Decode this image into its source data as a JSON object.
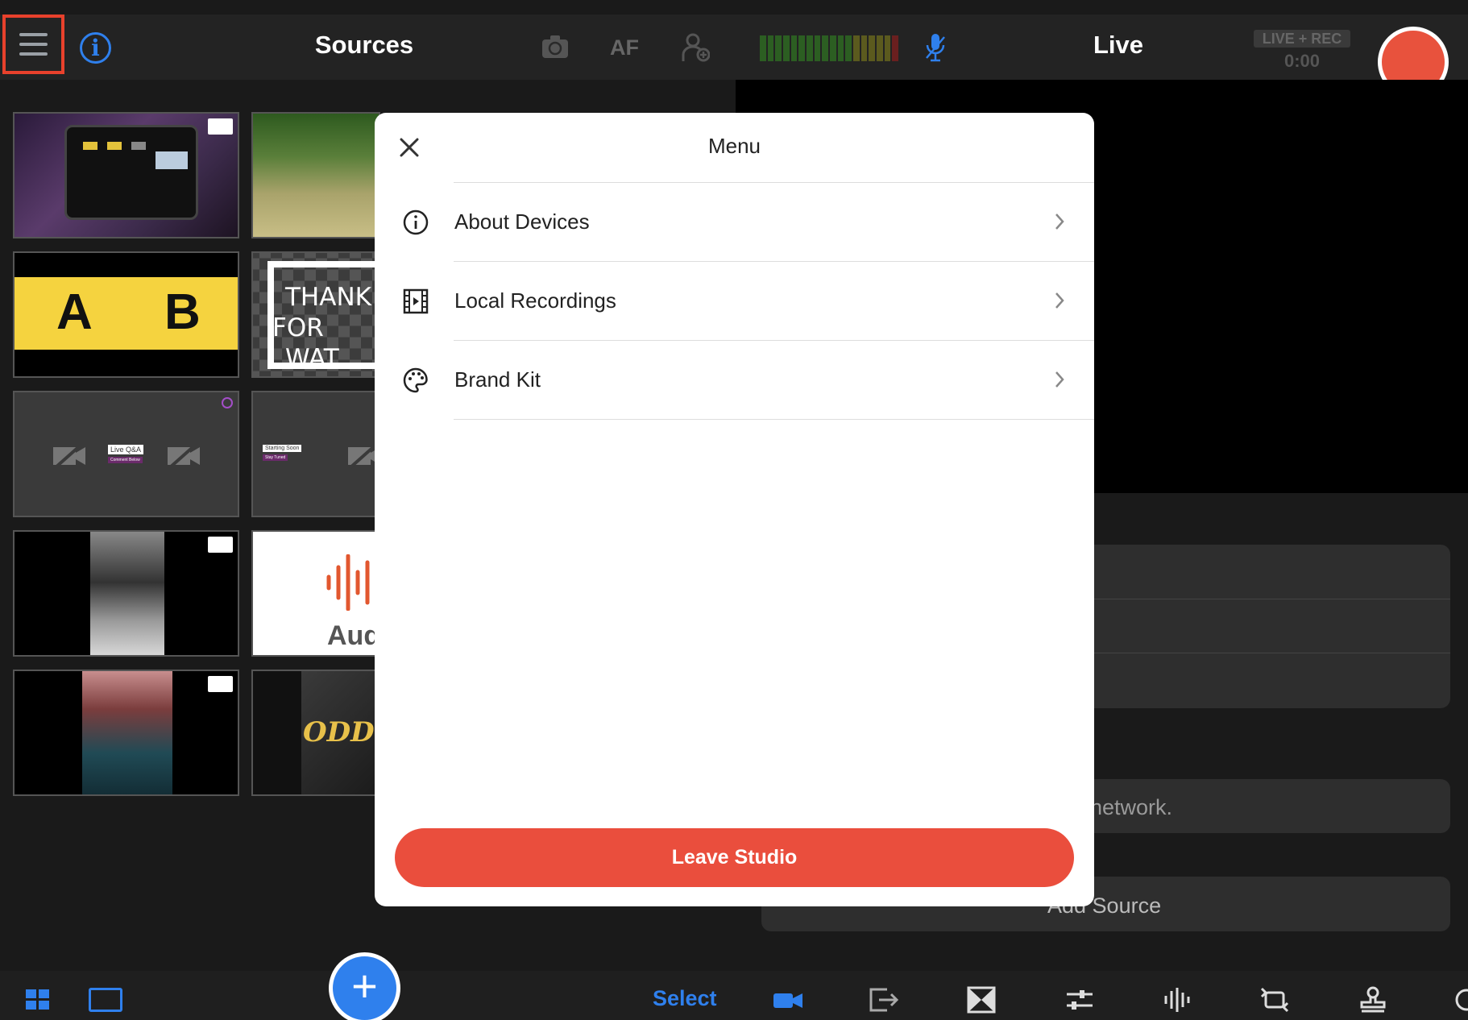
{
  "sources_panel": {
    "title": "Sources",
    "af_label": "AF",
    "tiles": {
      "thanks_text_line1": "THANK",
      "thanks_text_line2": "FOR WAT",
      "ab_left": "A",
      "ab_right": "B",
      "qa_label": "Live Q&A",
      "qa_sub": "Comment Below",
      "starting_label": "Starting Soon",
      "starting_sub": "Stay Tuned",
      "audio_label": "Aud",
      "odds_label": "ODDS"
    },
    "select_label": "Select",
    "add_label": "+"
  },
  "live_panel": {
    "title": "Live",
    "status_badge": "LIVE + REC",
    "timer": "0:00",
    "network_text": "network.",
    "add_source_label": "Add Source"
  },
  "menu": {
    "title": "Menu",
    "items": [
      {
        "label": "About Devices",
        "icon": "info-circle-icon"
      },
      {
        "label": "Local Recordings",
        "icon": "film-icon"
      },
      {
        "label": "Brand Kit",
        "icon": "palette-icon"
      }
    ],
    "leave_label": "Leave Studio"
  },
  "colors": {
    "accent_blue": "#2f80ed",
    "record_red": "#e8523d",
    "leave_red": "#ea4e3d",
    "highlight_red": "#e8412c"
  }
}
